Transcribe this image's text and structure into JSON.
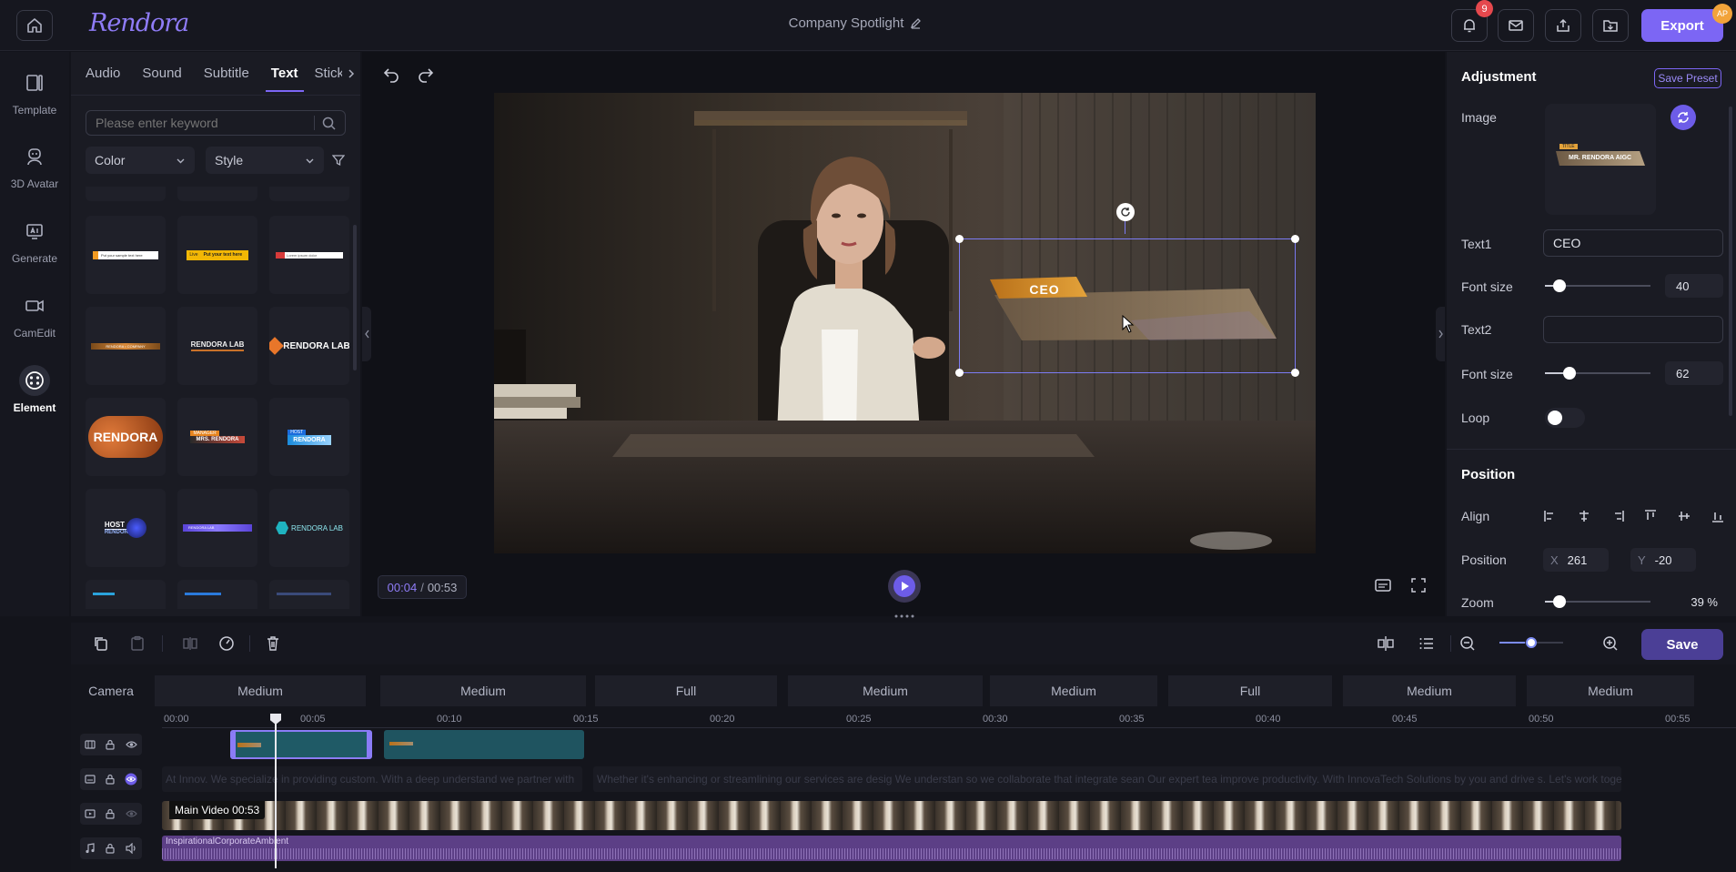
{
  "app": {
    "logo": "Rendora",
    "project_title": "Company Spotlight",
    "notifications": "9",
    "export_label": "Export",
    "user_initials": "AP"
  },
  "rail": [
    {
      "label": "Template",
      "icon": "template-icon"
    },
    {
      "label": "3D Avatar",
      "icon": "avatar-icon"
    },
    {
      "label": "Generate",
      "icon": "generate-icon"
    },
    {
      "label": "CamEdit",
      "icon": "camera-icon"
    },
    {
      "label": "Element",
      "icon": "element-icon",
      "active": true
    }
  ],
  "library": {
    "tabs": [
      "Audio",
      "Sound",
      "Subtitle",
      "Text",
      "Stick"
    ],
    "active_tab": "Text",
    "search_placeholder": "Please enter keyword",
    "filter_color": "Color",
    "filter_style": "Style",
    "thumbs": [
      {
        "t1": "Put your sample text here",
        "t2": ""
      },
      {
        "t1": "Put your text here",
        "t2": "Live"
      },
      {
        "t1": "Lorem ipsum dolor",
        "t2": ""
      },
      {
        "t1": "RENDORA • COMPANY",
        "t2": ""
      },
      {
        "t1": "RENDORA LAB",
        "t2": ""
      },
      {
        "t1": "RENDORA LAB",
        "t2": ""
      },
      {
        "t1": "RENDORA",
        "t2": ""
      },
      {
        "t1": "MRS. RENDORA",
        "t2": "MANAGER"
      },
      {
        "t1": "RENDORA",
        "t2": "HOST"
      },
      {
        "t1": "RENDORA",
        "t2": "HOST"
      },
      {
        "t1": "RENDORA LAB",
        "t2": ""
      },
      {
        "t1": "RENDORA LAB",
        "t2": ""
      }
    ]
  },
  "preview": {
    "overlay_text": "CEO",
    "time_current": "00:04",
    "time_total": "00:53"
  },
  "adjust": {
    "title": "Adjustment",
    "save_preset": "Save Preset",
    "image_label": "Image",
    "image_thumb_text": "MR. RENDORA AIGC",
    "image_thumb_tag": "TITLE",
    "text1_label": "Text1",
    "text1_value": "CEO",
    "font_size_label": "Font size",
    "font_size1": "40",
    "font_size1_fraction": 0.08,
    "text2_label": "Text2",
    "text2_value": "",
    "font_size2": "62",
    "font_size2_fraction": 0.17,
    "loop_label": "Loop",
    "position_title": "Position",
    "align_label": "Align",
    "position_label": "Position",
    "pos_x_label": "X",
    "pos_x": "261",
    "pos_y_label": "Y",
    "pos_y": "-20",
    "zoom_label": "Zoom",
    "zoom_value": "39 %",
    "zoom_fraction": 0.08
  },
  "toolbar": {
    "save_label": "Save",
    "zoom_fraction": 0.4
  },
  "timeline": {
    "camera_label": "Camera",
    "camera_cells": [
      "Medium",
      "Medium",
      "Full",
      "Medium",
      "Medium",
      "Full",
      "Medium",
      "Medium"
    ],
    "ticks": [
      "00:00",
      "00:05",
      "00:10",
      "00:15",
      "00:20",
      "00:25",
      "00:30",
      "00:35",
      "00:40",
      "00:45",
      "00:50",
      "00:55"
    ],
    "subtitle_a": "At Innov. We specialize in providing custom. With a deep understand we partner with",
    "subtitle_b": "Whether it's enhancing or streamlining our services are desig We understan so we collaborate that integrate sean Our expert tea improve productivity. With InnovaTech Solutions by you and drive s. Let's work togeth",
    "main_video_label": "Main Video 00:53",
    "audio_label": "InspirationalCorporateAmbient"
  },
  "colors": {
    "accent": "#7c66f4",
    "badge": "#e5484d",
    "overlay_gold": "#c98a1d"
  }
}
